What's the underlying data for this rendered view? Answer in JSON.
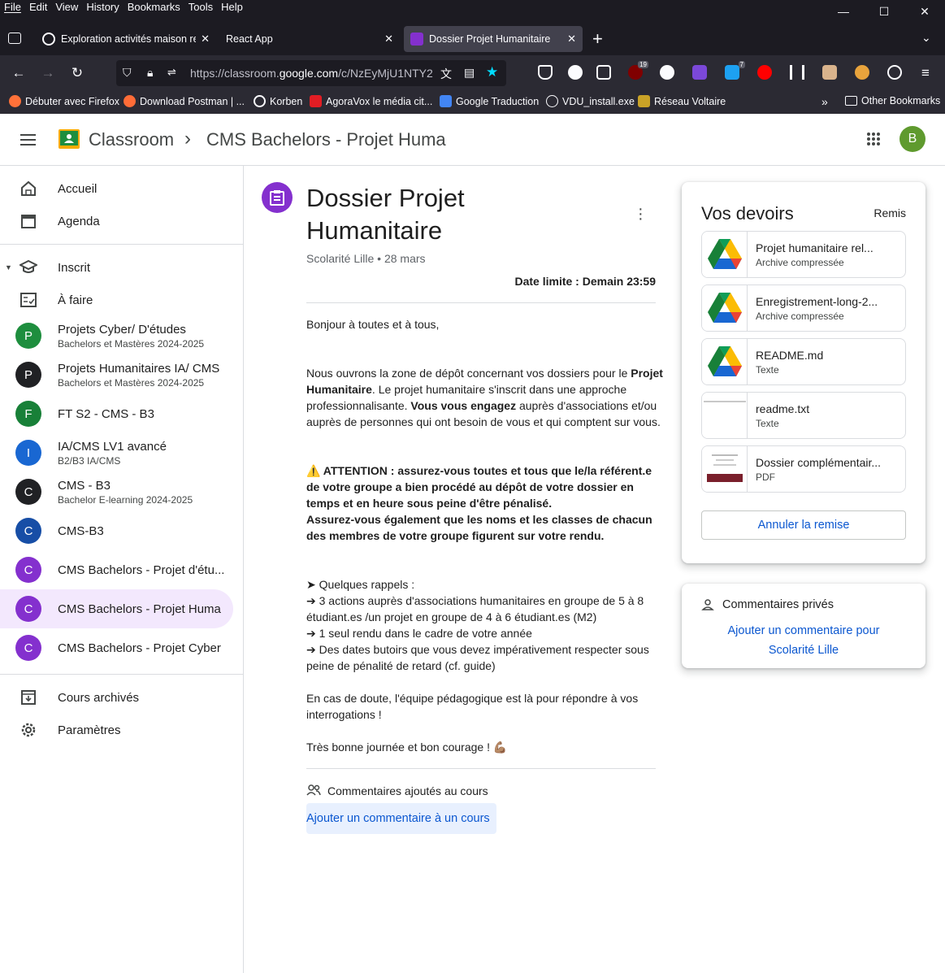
{
  "menubar": {
    "items": [
      "File",
      "Edit",
      "View",
      "History",
      "Bookmarks",
      "Tools",
      "Help"
    ]
  },
  "tabs": [
    {
      "label": "Exploration activités maison ret",
      "icon": "openai-icon"
    },
    {
      "label": "React App"
    },
    {
      "label": "Dossier Projet Humanitaire",
      "icon": "classroom-icon",
      "active": true
    }
  ],
  "url": {
    "prefix": "https://classroom.",
    "domain": "google.com",
    "suffix": "/c/NzEyMjU1NTY2"
  },
  "extensions": {
    "badge1": "19",
    "badge2": "7"
  },
  "bookmarks": [
    "Débuter avec Firefox",
    "Download Postman | ...",
    "Korben",
    "AgoraVox le média cit...",
    "Google Traduction",
    "VDU_install.exe",
    "Réseau Voltaire"
  ],
  "other_bookmarks": "Other Bookmarks",
  "header": {
    "app": "Classroom",
    "separator": "›",
    "course": "CMS Bachelors - Projet Huma",
    "avatar": "B"
  },
  "sidebar": {
    "home": "Accueil",
    "calendar": "Agenda",
    "enrolled": "Inscrit",
    "todo": "À faire",
    "courses": [
      {
        "letter": "P",
        "name": "Projets Cyber/ D'études",
        "sub": "Bachelors et Mastères 2024-2025",
        "color": "#1e8e3e"
      },
      {
        "letter": "P",
        "name": "Projets Humanitaires IA/ CMS",
        "sub": "Bachelors et Mastères 2024-2025",
        "color": "#202124"
      },
      {
        "letter": "F",
        "name": "FT S2 - CMS - B3",
        "sub": "",
        "color": "#188038"
      },
      {
        "letter": "I",
        "name": "IA/CMS LV1 avancé",
        "sub": "B2/B3 IA/CMS",
        "color": "#1967d2"
      },
      {
        "letter": "C",
        "name": "CMS - B3",
        "sub": "Bachelor E-learning 2024-2025",
        "color": "#202124"
      },
      {
        "letter": "C",
        "name": "CMS-B3",
        "sub": "",
        "color": "#174ea6"
      },
      {
        "letter": "C",
        "name": "CMS Bachelors - Projet d'étu...",
        "sub": "",
        "color": "#8430ce"
      },
      {
        "letter": "C",
        "name": "CMS Bachelors - Projet Huma",
        "sub": "",
        "color": "#8430ce"
      },
      {
        "letter": "C",
        "name": "CMS Bachelors - Projet Cyber",
        "sub": "",
        "color": "#8430ce"
      }
    ],
    "archived": "Cours archivés",
    "settings": "Paramètres"
  },
  "post": {
    "title_line1": "Dossier Projet",
    "title_line2": "Humanitaire",
    "meta": "Scolarité Lille • 28 mars",
    "due": "Date limite : Demain 23:59",
    "p1": "Bonjour à toutes et à tous,",
    "p2_a": "Nous ouvrons la zone de dépôt concernant vos dossiers pour le ",
    "p2_b": "Projet Humanitaire",
    "p2_c": ". Le projet humanitaire s'inscrit dans une approche professionnalisante. ",
    "p2_d": "Vous vous engagez",
    "p2_e": " auprès d'associations et/ou auprès de personnes qui ont besoin de vous et qui comptent sur vous.",
    "attention_icon": "⚠️",
    "attention": " ATTENTION : assurez-vous toutes et tous que le/la référent.e de votre groupe a bien procédé au dépôt de votre dossier en temps et en heure sous peine d'être pénalisé.",
    "attention2": "Assurez-vous également que les noms et les classes de chacun des membres de votre groupe figurent sur votre rendu.",
    "reminders": [
      "➤ Quelques rappels :",
      "➔ 3 actions auprès d'associations humanitaires en groupe de 5 à 8 étudiant.es /un projet en groupe de 4 à 6 étudiant.es (M2)",
      "➔ 1 seul rendu dans le cadre de votre année",
      "➔ Des dates butoirs que vous devez impérativement respecter sous peine de pénalité de retard (cf. guide)"
    ],
    "doubt": "En cas de doute, l'équipe pédagogique est là pour répondre à vos interrogations !",
    "closing": "Très bonne journée et bon courage ! 💪🏽",
    "comments_title": "Commentaires ajoutés au cours",
    "add_comment": "Ajouter un commentaire à un cours"
  },
  "work": {
    "title": "Vos devoirs",
    "status": "Remis",
    "files": [
      {
        "name": "Projet humanitaire rel...",
        "type": "Archive compressée",
        "thumb": "drive"
      },
      {
        "name": "Enregistrement-long-2...",
        "type": "Archive compressée",
        "thumb": "drive"
      },
      {
        "name": "README.md",
        "type": "Texte",
        "thumb": "drive"
      },
      {
        "name": "readme.txt",
        "type": "Texte",
        "thumb": "doc"
      },
      {
        "name": "Dossier complémentair...",
        "type": "PDF",
        "thumb": "pdf"
      }
    ],
    "unsubmit": "Annuler la remise"
  },
  "private": {
    "title": "Commentaires privés",
    "add_line1": "Ajouter un commentaire pour",
    "add_line2": "Scolarité Lille"
  }
}
